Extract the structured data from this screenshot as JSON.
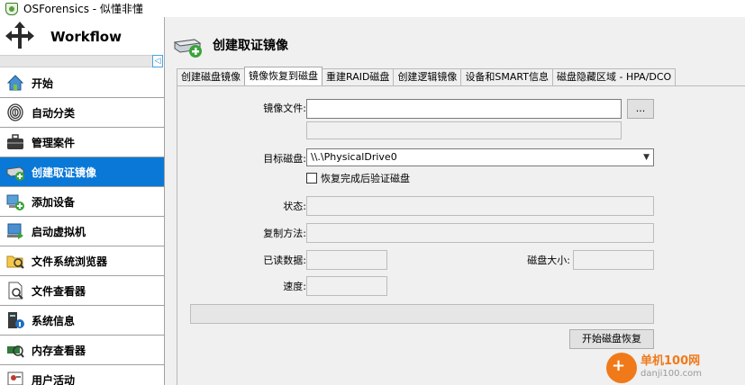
{
  "window": {
    "title": "OSForensics - 似懂非懂"
  },
  "sidebar": {
    "header": "Workflow",
    "scroll_arrow": "◁",
    "items": [
      {
        "label": "开始",
        "icon": "home-icon"
      },
      {
        "label": "自动分类",
        "icon": "fingerprint-icon"
      },
      {
        "label": "管理案件",
        "icon": "briefcase-icon"
      },
      {
        "label": "创建取证镜像",
        "icon": "drive-add-icon",
        "active": true
      },
      {
        "label": "添加设备",
        "icon": "add-device-icon"
      },
      {
        "label": "启动虚拟机",
        "icon": "vm-icon"
      },
      {
        "label": "文件系统浏览器",
        "icon": "folder-browser-icon"
      },
      {
        "label": "文件查看器",
        "icon": "file-viewer-icon"
      },
      {
        "label": "系统信息",
        "icon": "system-info-icon"
      },
      {
        "label": "内存查看器",
        "icon": "memory-viewer-icon"
      },
      {
        "label": "用户活动",
        "icon": "user-activity-icon"
      }
    ]
  },
  "main": {
    "title": "创建取证镜像",
    "tabs": [
      {
        "label": "创建磁盘镜像"
      },
      {
        "label": "镜像恢复到磁盘",
        "active": true
      },
      {
        "label": "重建RAID磁盘"
      },
      {
        "label": "创建逻辑镜像"
      },
      {
        "label": "设备和SMART信息"
      },
      {
        "label": "磁盘隐藏区域 - HPA/DCO"
      }
    ],
    "form": {
      "image_file_label": "镜像文件:",
      "image_file_value": "",
      "browse_label": "...",
      "target_disk_label": "目标磁盘:",
      "target_disk_value": "\\\\.\\PhysicalDrive0",
      "verify_label": "恢复完成后验证磁盘",
      "status_label": "状态:",
      "status_value": "",
      "copy_method_label": "复制方法:",
      "copy_method_value": "",
      "read_label": "已读数据:",
      "read_value": "",
      "disk_size_label": "磁盘大小:",
      "disk_size_value": "",
      "speed_label": "速度:",
      "speed_value": "",
      "progress": 0,
      "start_button": "开始磁盘恢复"
    }
  },
  "watermark": {
    "text": "单机100网",
    "url": "danji100.com"
  }
}
